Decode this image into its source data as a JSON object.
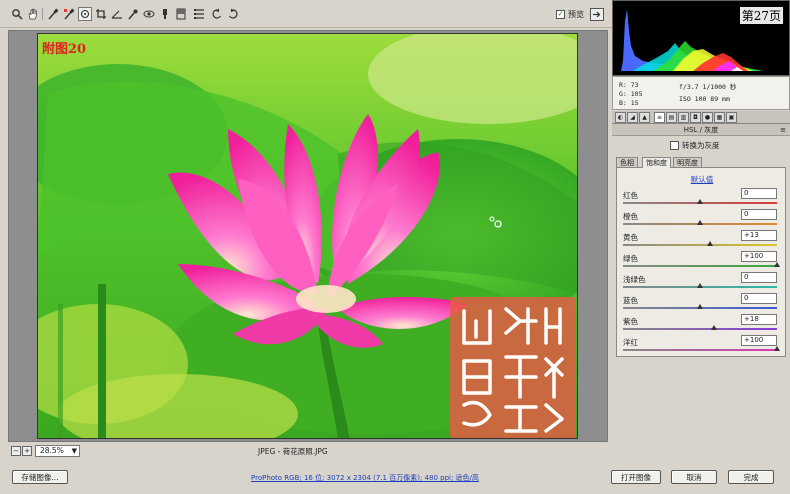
{
  "toolbar": {
    "tools": [
      "zoom-icon",
      "hand-icon",
      "white-balance-icon",
      "color-sampler-icon",
      "target-adjust-icon",
      "crop-icon",
      "straighten-icon",
      "spot-removal-icon",
      "red-eye-icon",
      "adjustment-brush-icon",
      "graduated-filter-icon",
      "preferences-icon",
      "rotate-ccw-icon",
      "rotate-cw-icon"
    ],
    "preview_label": "预览",
    "preview_checked": true
  },
  "canvas": {
    "figure_label": "附图20",
    "zoom": "28.5%",
    "filename": "JPEG -  荷花原照.JPG"
  },
  "histogram": {
    "page_label": "第27页"
  },
  "info": {
    "r": "R:  73",
    "g": "G: 105",
    "b": "B:  15",
    "exposure": "f/3.7  1/1000 秒",
    "iso": "ISO 100  89 mm"
  },
  "panel": {
    "title": "HSL / 灰度",
    "convert_gray_label": "转换为灰度",
    "tabs": [
      "色相",
      "饱和度",
      "明亮度"
    ],
    "active_tab": 1,
    "defaults_label": "默认值",
    "sliders": [
      {
        "label": "红色",
        "value": "0",
        "level": 0,
        "color": "#d83a3a"
      },
      {
        "label": "橙色",
        "value": "0",
        "level": 0,
        "color": "#e48a2a"
      },
      {
        "label": "黄色",
        "value": "+13",
        "level": 13,
        "color": "#d8c82a"
      },
      {
        "label": "绿色",
        "value": "+100",
        "level": 100,
        "color": "#3aa83a"
      },
      {
        "label": "浅绿色",
        "value": "0",
        "level": 0,
        "color": "#2ab8a8"
      },
      {
        "label": "蓝色",
        "value": "0",
        "level": 0,
        "color": "#3a5ad8"
      },
      {
        "label": "紫色",
        "value": "+18",
        "level": 18,
        "color": "#8a3ad8"
      },
      {
        "label": "洋红",
        "value": "+100",
        "level": 100,
        "color": "#d83ab8"
      }
    ]
  },
  "bottom": {
    "save_label": "存储图像...",
    "workflow_link": "ProPhoto RGB; 16 位; 3072 x 2304 (7.1 百万像素); 480 ppi; 适色/高",
    "open_label": "打开图像",
    "cancel_label": "取消",
    "done_label": "完成"
  }
}
